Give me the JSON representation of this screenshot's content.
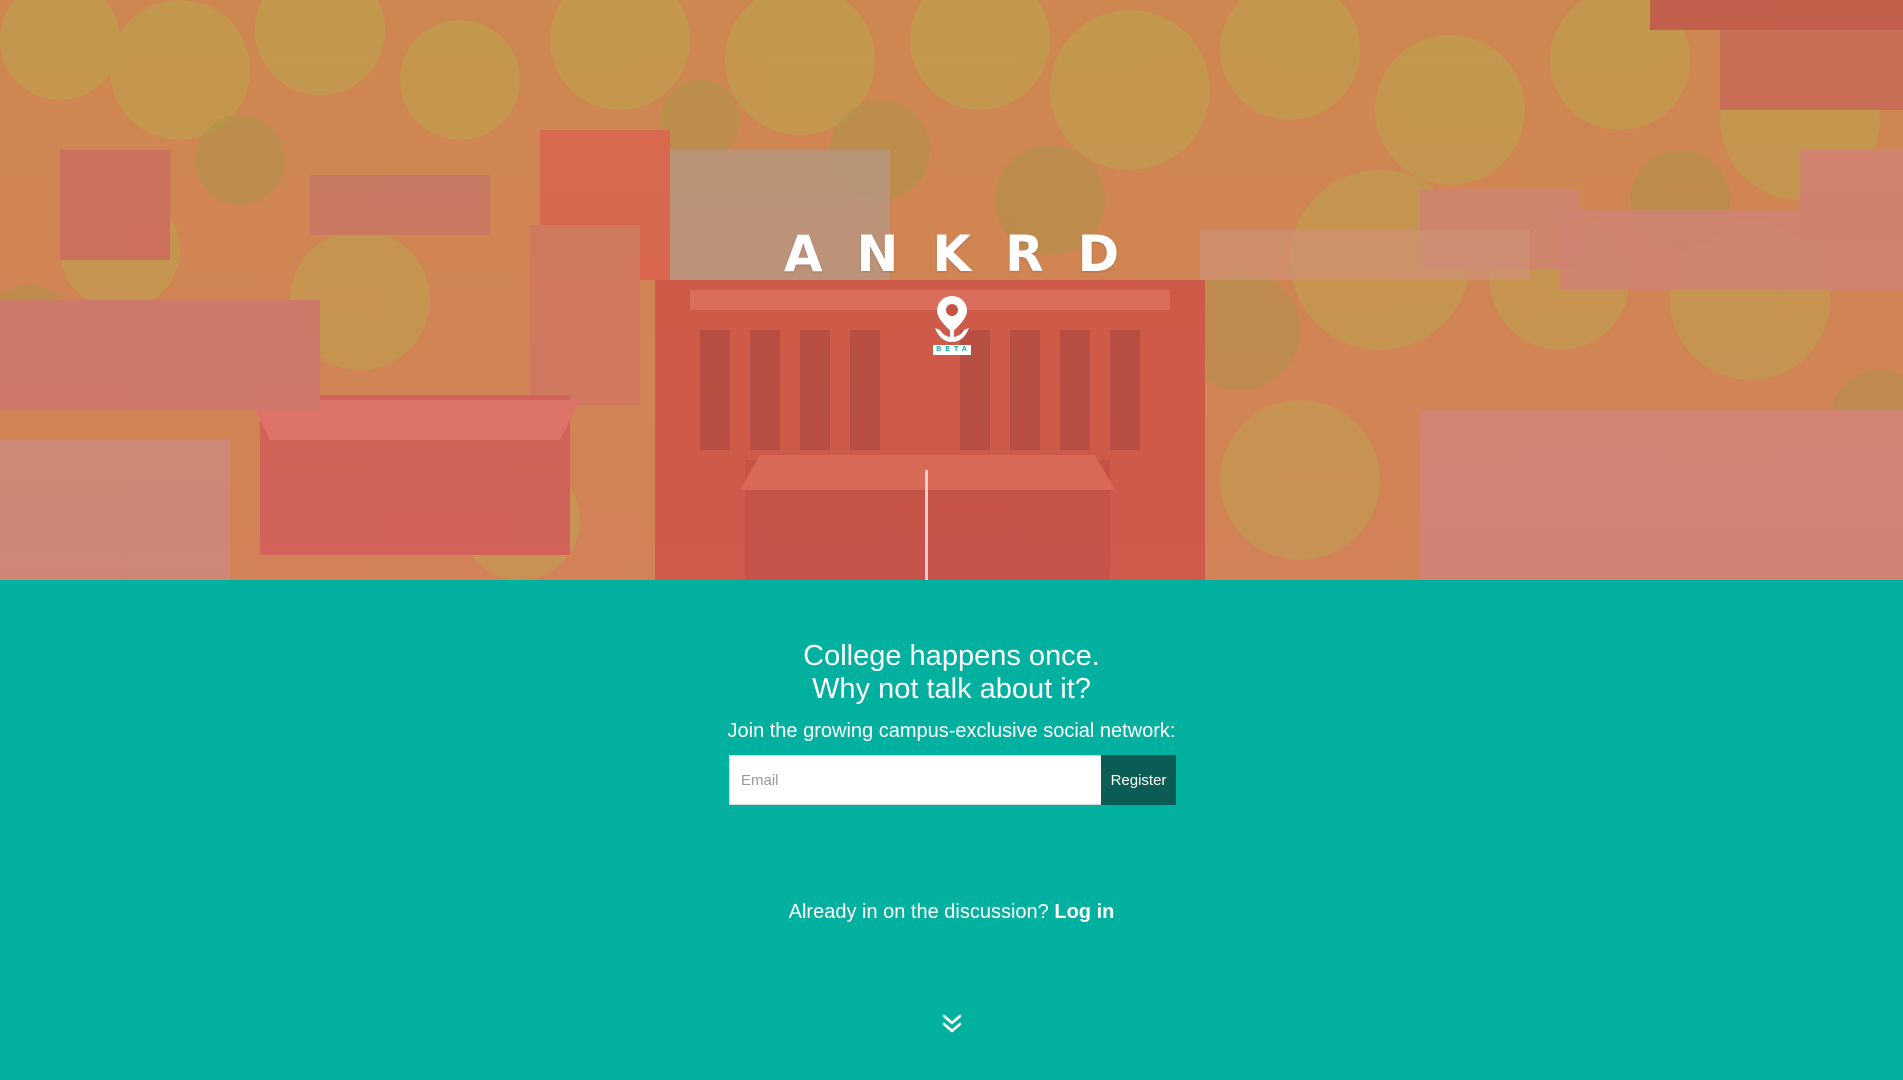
{
  "brand": {
    "wordmark": "ANKRD",
    "badge": "BETA",
    "logo_icon": "anchor-pin-icon"
  },
  "hero": {
    "background": "aerial-campus-photo",
    "tint_color": "#e07a6a"
  },
  "signup": {
    "headline_line1": "College happens once.",
    "headline_line2": "Why not talk about it?",
    "subline": "Join the growing campus-exclusive social network:",
    "email_placeholder": "Email",
    "register_label": "Register",
    "login_prompt": "Already in on the discussion?",
    "login_label": "Log in",
    "scroll_icon": "double-chevron-down-icon"
  },
  "colors": {
    "teal_background": "#02b0a0",
    "register_button": "#0b5c55",
    "text": "#ffffff"
  }
}
